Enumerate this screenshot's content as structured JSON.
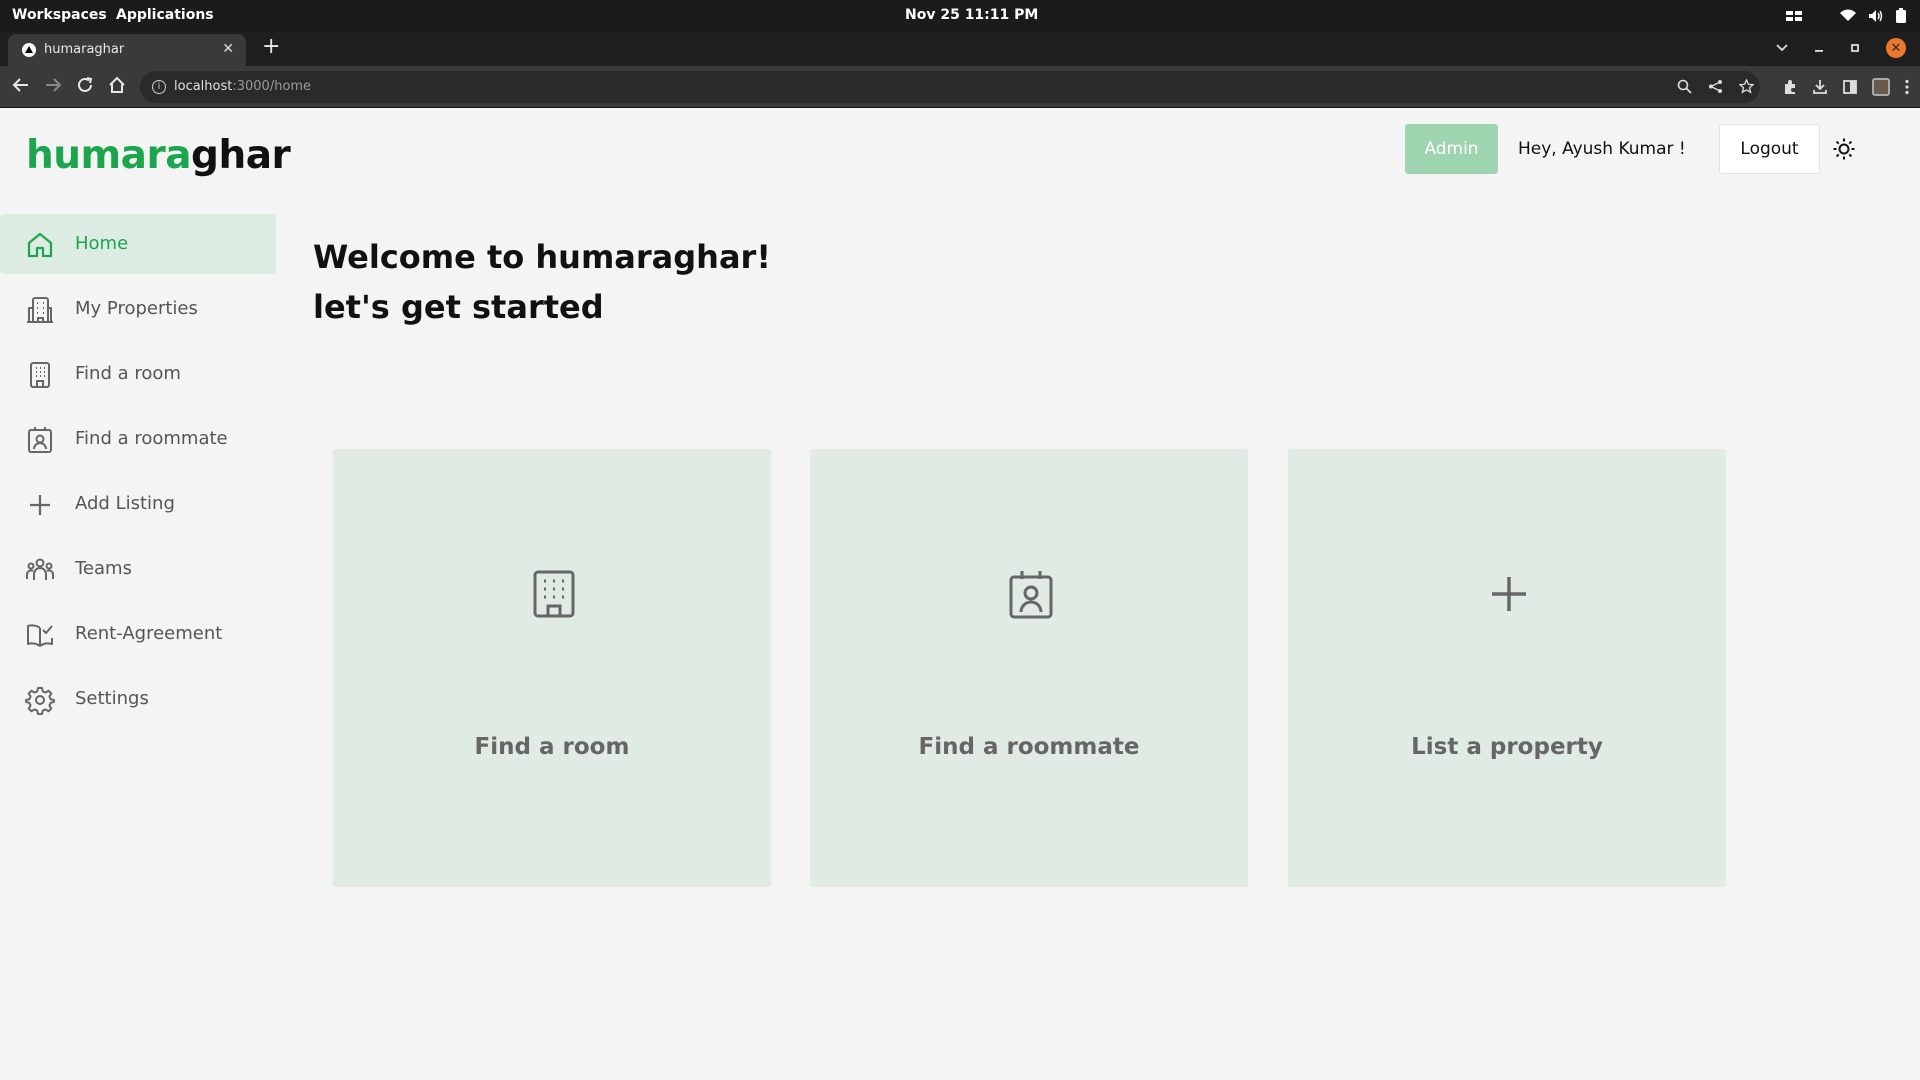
{
  "os": {
    "workspaces": "Workspaces",
    "applications": "Applications",
    "clock": "Nov 25  11:11 PM"
  },
  "browser": {
    "tab_title": "humaraghar",
    "url_host": "localhost",
    "url_path": ":3000/home"
  },
  "app": {
    "logo_part1": "humara",
    "logo_part2": "ghar",
    "admin_label": "Admin",
    "greeting": "Hey, Ayush Kumar !",
    "logout_label": "Logout",
    "accent_color": "#1da54e"
  },
  "sidebar": {
    "items": [
      {
        "label": "Home",
        "icon": "home-icon",
        "active": true
      },
      {
        "label": "My Properties",
        "icon": "buildings-icon"
      },
      {
        "label": "Find a room",
        "icon": "building-icon"
      },
      {
        "label": "Find a roommate",
        "icon": "contact-badge-icon"
      },
      {
        "label": "Add Listing",
        "icon": "plus-icon"
      },
      {
        "label": "Teams",
        "icon": "team-icon"
      },
      {
        "label": "Rent-Agreement",
        "icon": "book-check-icon"
      },
      {
        "label": "Settings",
        "icon": "gear-icon"
      }
    ]
  },
  "main": {
    "welcome_line1": "Welcome to humaraghar!",
    "welcome_line2": "let's get started",
    "cards": [
      {
        "label": "Find a room",
        "icon": "building-icon"
      },
      {
        "label": "Find a roommate",
        "icon": "contact-badge-icon"
      },
      {
        "label": "List a property",
        "icon": "plus-icon"
      }
    ]
  }
}
